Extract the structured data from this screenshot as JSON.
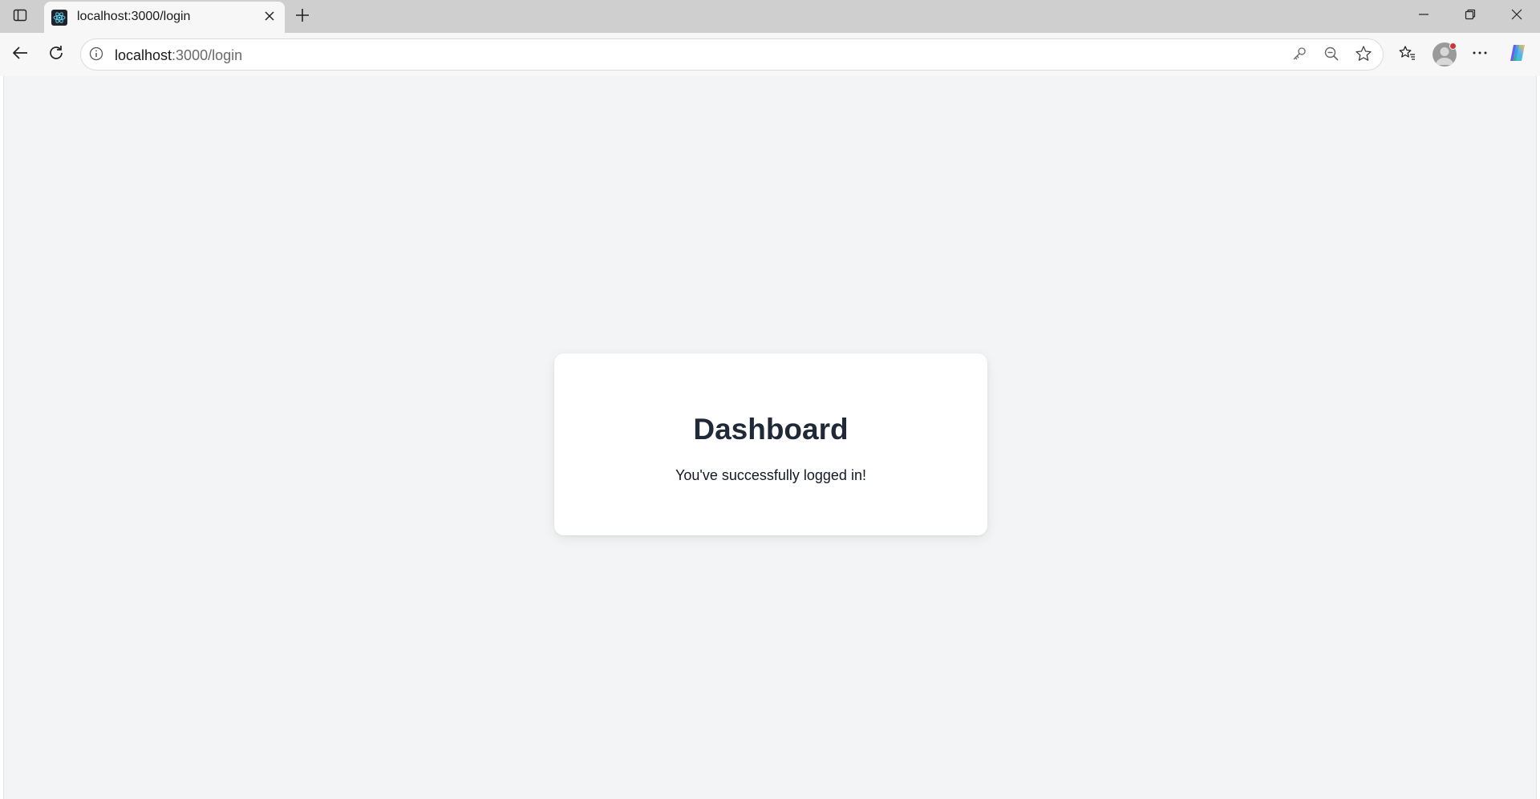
{
  "browser": {
    "tab": {
      "title": "localhost:3000/login",
      "favicon": "react-icon"
    },
    "address_bar": {
      "host": "localhost",
      "path": ":3000/login"
    },
    "icons": [
      "sidebar-icon",
      "close-icon",
      "plus-icon",
      "minimize-icon",
      "restore-icon",
      "back-icon",
      "reload-icon",
      "info-icon",
      "key-icon",
      "zoom-out-icon",
      "star-icon",
      "favorites-icon",
      "more-icon",
      "copilot-icon"
    ],
    "colors": {
      "tabstrip": "#cfcfcf",
      "toolbar": "#f7f7f7",
      "notification_dot": "#d13438"
    }
  },
  "page": {
    "background": "#f3f4f6",
    "card": {
      "title": "Dashboard",
      "message": "You've successfully logged in!"
    }
  }
}
